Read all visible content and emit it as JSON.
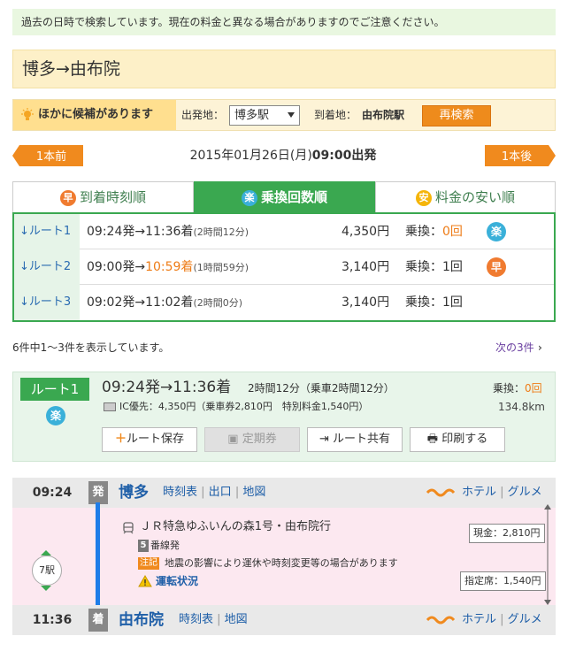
{
  "notice": "過去の日時で検索しています。現在の料金と異なる場合がありますのでご注意ください。",
  "title": "博多→由布院",
  "candidates": {
    "label": "ほかに候補があります",
    "from_label": "出発地：",
    "from_value": "博多駅",
    "to_label": "到着地：",
    "to_value": "由布院駅",
    "research": "再検索"
  },
  "nav": {
    "prev": "1本前",
    "next": "1本後",
    "date": "2015年01月26日(月)",
    "time": "09:00出発"
  },
  "tabs": [
    {
      "icon": "早",
      "label": "到着時刻順"
    },
    {
      "icon": "楽",
      "label": "乗換回数順"
    },
    {
      "icon": "安",
      "label": "料金の安い順"
    }
  ],
  "routes": [
    {
      "label": "↓ルート1",
      "depart": "09:24発→",
      "arrive": "11:36着",
      "duration": "(2時間12分)",
      "fare": "4,350円",
      "transfer_label": "乗換：",
      "transfer": "0回",
      "mark": "楽"
    },
    {
      "label": "↓ルート2",
      "depart": "09:00発→",
      "arrive": "10:59着",
      "duration": "(1時間59分)",
      "fare": "3,140円",
      "transfer_label": "乗換：",
      "transfer": "1回",
      "mark": "早"
    },
    {
      "label": "↓ルート3",
      "depart": "09:02発→",
      "arrive": "11:02着",
      "duration": "(2時間0分)",
      "fare": "3,140円",
      "transfer_label": "乗換：",
      "transfer": "1回",
      "mark": ""
    }
  ],
  "count": "6件中1〜3件を表示しています。",
  "next3": "次の3件",
  "detail": {
    "badge": "ルート1",
    "mark": "楽",
    "times": "09:24発→11:36着",
    "duration": "2時間12分（乗車2時間12分）",
    "transfer_label": "乗換：",
    "transfer": "0回",
    "fare_info": "IC優先：4,350円（乗車券2,810円　特別料金1,540円）",
    "distance": "134.8km",
    "buttons": {
      "save": "ルート保存",
      "pass": "定期券",
      "share": "ルート共有",
      "print": "印刷する"
    }
  },
  "segment": {
    "dep_time": "09:24",
    "dep_tag": "発",
    "dep_station": "博多",
    "links": [
      "時刻表",
      "出口",
      "地図"
    ],
    "hotel": "ホテル",
    "gourmet": "グルメ",
    "stops": "7駅",
    "train": "ＪＲ特急ゆふいんの森1号・由布院行",
    "platform_num": "5",
    "platform": "番線発",
    "note_tag": "注記",
    "note": "地震の影響により運休や時刻変更等の場合があります",
    "status": "運転状況",
    "fare_cash": "現金：2,810円",
    "fare_seat": "指定席：1,540円",
    "arr_time": "11:36",
    "arr_tag": "着",
    "arr_station": "由布院",
    "arr_links": [
      "時刻表",
      "地図"
    ]
  },
  "colors": {
    "green": "#3aa850",
    "orange": "#f08a1e",
    "blue": "#1f5fa8",
    "raku": "#3ab0d9",
    "haya": "#f07b30",
    "yasu": "#f5b50a"
  }
}
